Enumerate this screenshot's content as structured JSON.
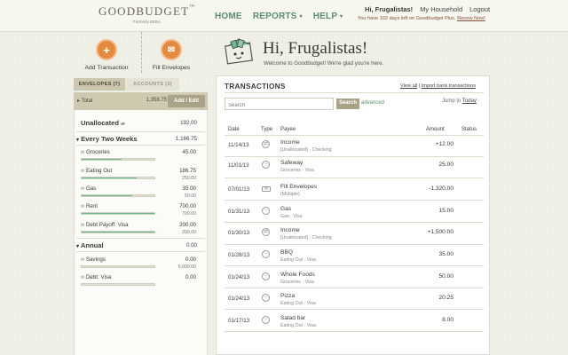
{
  "header": {
    "logo": "GOODBUDGET",
    "logo_tm": "™",
    "logo_sub": "Formerly EEBA",
    "nav": [
      "HOME",
      "REPORTS",
      "HELP"
    ],
    "nav_caret": "▾",
    "greeting": "Hi, Frugalistas!",
    "household": "My Household",
    "logout": "Logout",
    "plus_notice": "You have 102 days left on Goodbudget Plus.",
    "renew": "Renew Now!"
  },
  "actions": {
    "add_transaction": "Add Transaction",
    "fill_envelopes": "Fill Envelopes",
    "add_icon": "plus-icon",
    "fill_icon": "envelope-fill-icon"
  },
  "tabs": {
    "envelopes": "ENVELOPES (7)",
    "accounts": "ACCOUNTS (3)"
  },
  "total": {
    "label": "Total",
    "value": "1,358.75",
    "button": "Add / Edit"
  },
  "unallocated": {
    "label": "Unallocated",
    "value": "192.00"
  },
  "groups": [
    {
      "name": "Every Two Weeks",
      "value": "1,166.75"
    },
    {
      "name": "Annual",
      "value": "0.00"
    }
  ],
  "envelopes": [
    {
      "name": "Groceries",
      "v1": "45.00",
      "v2": "",
      "fill": 0.55
    },
    {
      "name": "Eating Out",
      "v1": "186.75",
      "v2": "250.00",
      "fill": 0.75
    },
    {
      "name": "Gas",
      "v1": "35.00",
      "v2": "50.00",
      "fill": 0.7
    },
    {
      "name": "Rent",
      "v1": "700.00",
      "v2": "700.00",
      "fill": 1.0
    },
    {
      "name": "Debt Payoff: Visa",
      "v1": "200.00",
      "v2": "200.00",
      "fill": 1.0
    },
    {
      "name": "Savings",
      "v1": "0.00",
      "v2": "5,000.00",
      "fill": 0
    },
    {
      "name": "Debt: Visa",
      "v1": "0.00",
      "v2": "",
      "fill": 0
    }
  ],
  "main": {
    "title": "Hi, Frugalistas!",
    "welcome": "Welcome to Goodbudget! We're glad you're here.",
    "tx_title": "TRANSACTIONS",
    "view_all": "View all",
    "import": "Import bank transactions",
    "search_placeholder": "Search",
    "search_button": "Search",
    "advanced": "advanced",
    "jump": "Jump to",
    "today": "Today",
    "columns": [
      "Date",
      "Type",
      "Payee",
      "Amount",
      "Status"
    ]
  },
  "transactions": [
    {
      "date": "11/14/13",
      "type": "⇄",
      "payee": "Income",
      "sub": "[Unallocated] · Checking",
      "amount": "+12.00"
    },
    {
      "date": "11/01/13",
      "type": "−",
      "payee": "Safeway",
      "sub": "Groceries · Visa",
      "amount": "25.00"
    },
    {
      "date": "07/01/13",
      "type": "✉",
      "payee": "Fill Envelopes",
      "sub": "(Multiple)",
      "amount": "-1,320.00"
    },
    {
      "date": "01/31/13",
      "type": "−",
      "payee": "Gas",
      "sub": "Gas · Visa",
      "amount": "15.00"
    },
    {
      "date": "01/30/13",
      "type": "⇄",
      "payee": "Income",
      "sub": "[Unallocated] · Checking",
      "amount": "+1,500.00"
    },
    {
      "date": "01/28/13",
      "type": "−",
      "payee": "BBQ",
      "sub": "Eating Out · Visa",
      "amount": "35.00"
    },
    {
      "date": "01/24/13",
      "type": "−",
      "payee": "Whole Foods",
      "sub": "Groceries · Visa",
      "amount": "50.00"
    },
    {
      "date": "01/24/13",
      "type": "−",
      "payee": "Pizza",
      "sub": "Eating Out · Visa",
      "amount": "20.25"
    },
    {
      "date": "01/17/13",
      "type": "−",
      "payee": "Salad bar",
      "sub": "Eating Out · Visa",
      "amount": "8.00"
    }
  ]
}
